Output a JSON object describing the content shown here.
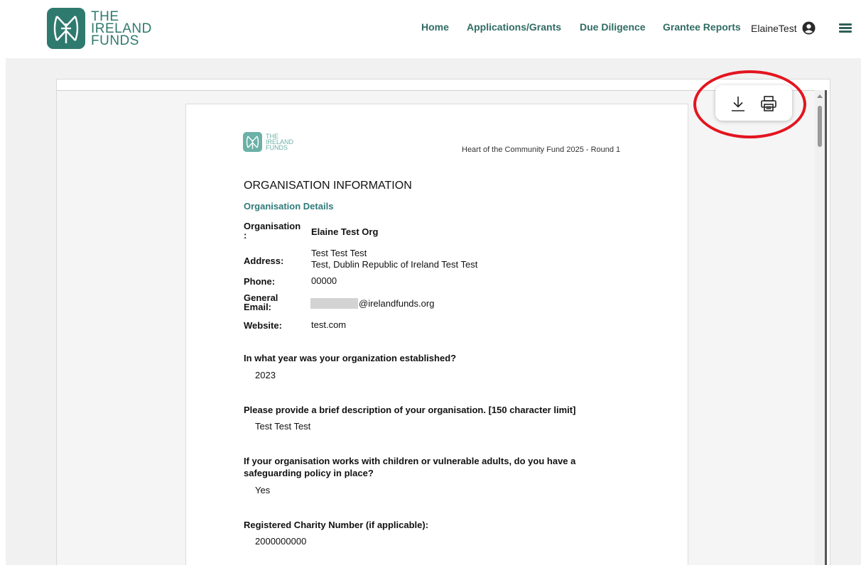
{
  "header": {
    "logo_lines": [
      "THE",
      "IRELAND",
      "FUNDS"
    ],
    "nav": [
      {
        "label": "Home"
      },
      {
        "label": "Applications/Grants"
      },
      {
        "label": "Due Diligence"
      },
      {
        "label": "Grantee Reports"
      }
    ],
    "username": "ElaineTest"
  },
  "toolbar": {
    "download_icon": "download-icon",
    "print_icon": "print-icon"
  },
  "document": {
    "logo_lines": [
      "THE",
      "IRELAND",
      "FUNDS"
    ],
    "fund_name": "Heart of the Community Fund 2025 - Round 1",
    "section_title": "ORGANISATION INFORMATION",
    "subsection_title": "Organisation Details",
    "details": {
      "organisation_label_1": "Organisation",
      "organisation_label_2": ":",
      "organisation_value": "Elaine Test Org",
      "address_label": "Address:",
      "address_line1": "Test Test Test",
      "address_line2": "Test, Dublin Republic of Ireland Test Test",
      "phone_label": "Phone:",
      "phone_value": "00000",
      "email_label_1": "General",
      "email_label_2": "Email:",
      "email_value": "@irelandfunds.org",
      "website_label": "Website:",
      "website_value": "test.com"
    },
    "questions": [
      {
        "q": "In what year was your organization established?",
        "a": "2023"
      },
      {
        "q": "Please provide a brief description of your organisation. [150 character limit]",
        "a": "Test Test Test"
      },
      {
        "q": "If your organisation works with children or vulnerable adults, do you have a safeguarding policy in place?",
        "a": "Yes"
      },
      {
        "q": "Registered Charity Number (if applicable):",
        "a": "2000000000"
      }
    ]
  },
  "colors": {
    "brand": "#2f7a6e",
    "nav_text": "#2f6b62",
    "highlight": "#e3151f"
  }
}
